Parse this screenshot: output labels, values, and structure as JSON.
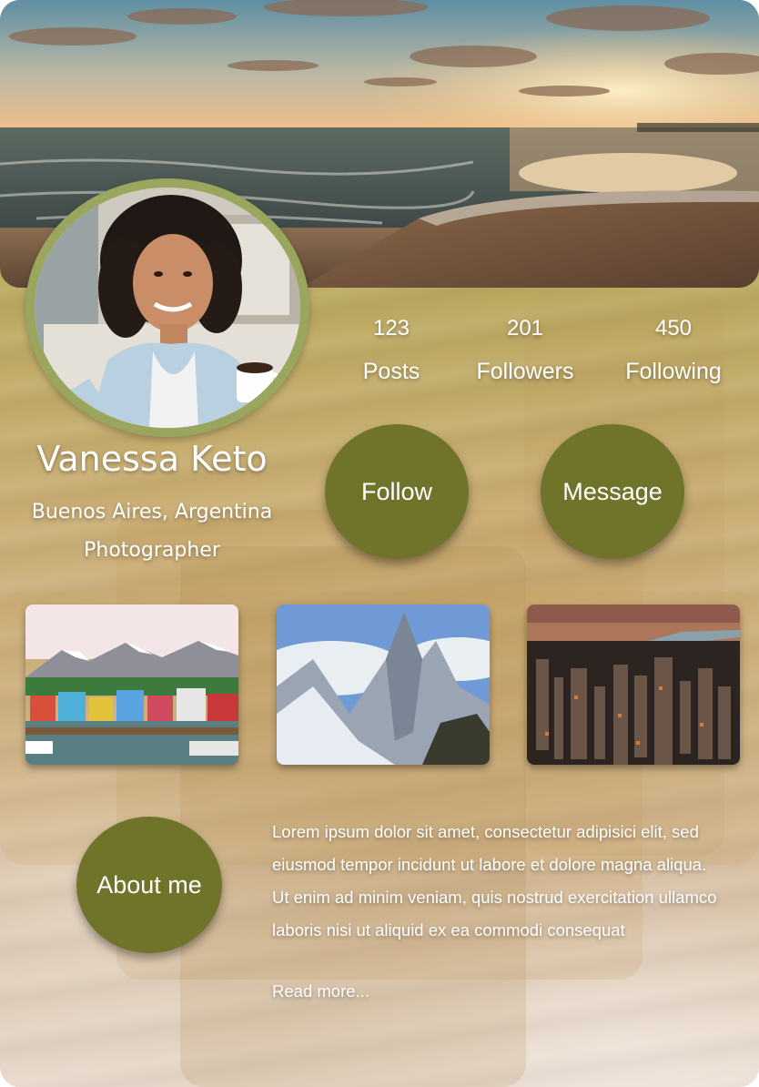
{
  "profile": {
    "name": "Vanessa Keto",
    "location": "Buenos Aires, Argentina",
    "role": "Photographer"
  },
  "stats": [
    {
      "value": "123",
      "label": "Posts"
    },
    {
      "value": "201",
      "label": "Followers"
    },
    {
      "value": "450",
      "label": "Following"
    }
  ],
  "actions": {
    "follow_label": "Follow",
    "message_label": "Message",
    "about_label": "About me"
  },
  "gallery": [
    {
      "subject": "colorful harbor town with snowy mountains"
    },
    {
      "subject": "jagged snowy mountain peaks"
    },
    {
      "subject": "aerial city skyline at sunset"
    }
  ],
  "about": {
    "text": "Lorem ipsum dolor sit amet, consectetur adipisici elit, sed eiusmod tempor incidunt ut labore et dolore magna aliqua. Ut enim ad minim veniam, quis nostrud exercitation ullamco laboris nisi ut aliquid ex ea commodi consequat",
    "read_more": "Read more..."
  },
  "colors": {
    "button": "#6f742a",
    "avatar_ring": "#9aa55e",
    "text": "#ffffff"
  }
}
